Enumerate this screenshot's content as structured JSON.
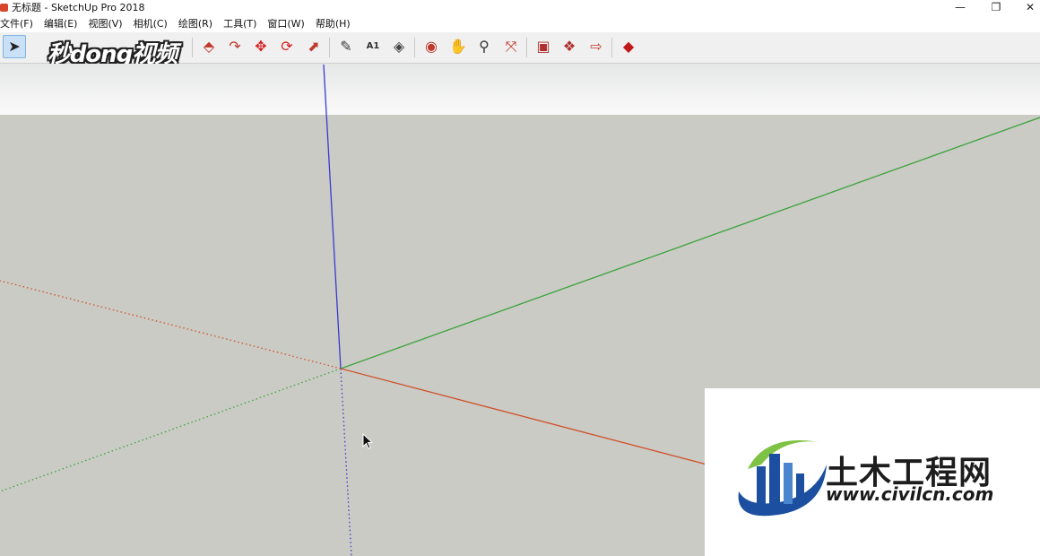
{
  "window": {
    "title": "无标题 - SketchUp Pro 2018",
    "minimize_glyph": "—",
    "restore_glyph": "❐",
    "close_glyph": "✕"
  },
  "menubar": {
    "items": [
      {
        "label": "文件(F)"
      },
      {
        "label": "编辑(E)"
      },
      {
        "label": "视图(V)"
      },
      {
        "label": "相机(C)"
      },
      {
        "label": "绘图(R)"
      },
      {
        "label": "工具(T)"
      },
      {
        "label": "窗口(W)"
      },
      {
        "label": "帮助(H)"
      }
    ]
  },
  "toolbar": {
    "tools": [
      {
        "icon": "select-arrow-icon",
        "glyph": "➤",
        "color": "#222222"
      },
      {
        "icon": "push-pull-icon",
        "glyph": "⬘",
        "color": "#c0392b"
      },
      {
        "icon": "follow-me-icon",
        "glyph": "↷",
        "color": "#c0392b"
      },
      {
        "icon": "move-icon",
        "glyph": "✥",
        "color": "#d62020"
      },
      {
        "icon": "rotate-icon",
        "glyph": "⟳",
        "color": "#d62020"
      },
      {
        "icon": "scale-icon",
        "glyph": "⬈",
        "color": "#c0392b"
      },
      {
        "icon": "tape-measure-icon",
        "glyph": "✎",
        "color": "#3b3b3b"
      },
      {
        "icon": "text-label-icon",
        "glyph": "A1",
        "color": "#333333"
      },
      {
        "icon": "paint-bucket-icon",
        "glyph": "◈",
        "color": "#444444"
      },
      {
        "icon": "orbit-icon",
        "glyph": "◉",
        "color": "#c0392b"
      },
      {
        "icon": "pan-hand-icon",
        "glyph": "✋",
        "color": "#d08a2c"
      },
      {
        "icon": "zoom-icon",
        "glyph": "⚲",
        "color": "#333333"
      },
      {
        "icon": "zoom-extents-icon",
        "glyph": "⤧",
        "color": "#c0392b"
      },
      {
        "icon": "warehouse-icon",
        "glyph": "▣",
        "color": "#b03030"
      },
      {
        "icon": "extension-warehouse-icon",
        "glyph": "❖",
        "color": "#b03030"
      },
      {
        "icon": "share-model-icon",
        "glyph": "⇨",
        "color": "#c0392b"
      },
      {
        "icon": "ruby-console-icon",
        "glyph": "◆",
        "color": "#c01818"
      }
    ]
  },
  "watermark_top": {
    "text": "秒dong视频"
  },
  "brand": {
    "name": "土木工程网",
    "url": "www.civilcn.com",
    "primary_color": "#1c4fa0",
    "accent_color": "#7dc242"
  },
  "colors": {
    "sky_top": "#e6e7e7",
    "ground": "#cacbc5",
    "axis_blue": "#3a3ad0",
    "axis_green": "#3aa33a",
    "axis_red": "#d0502a"
  }
}
